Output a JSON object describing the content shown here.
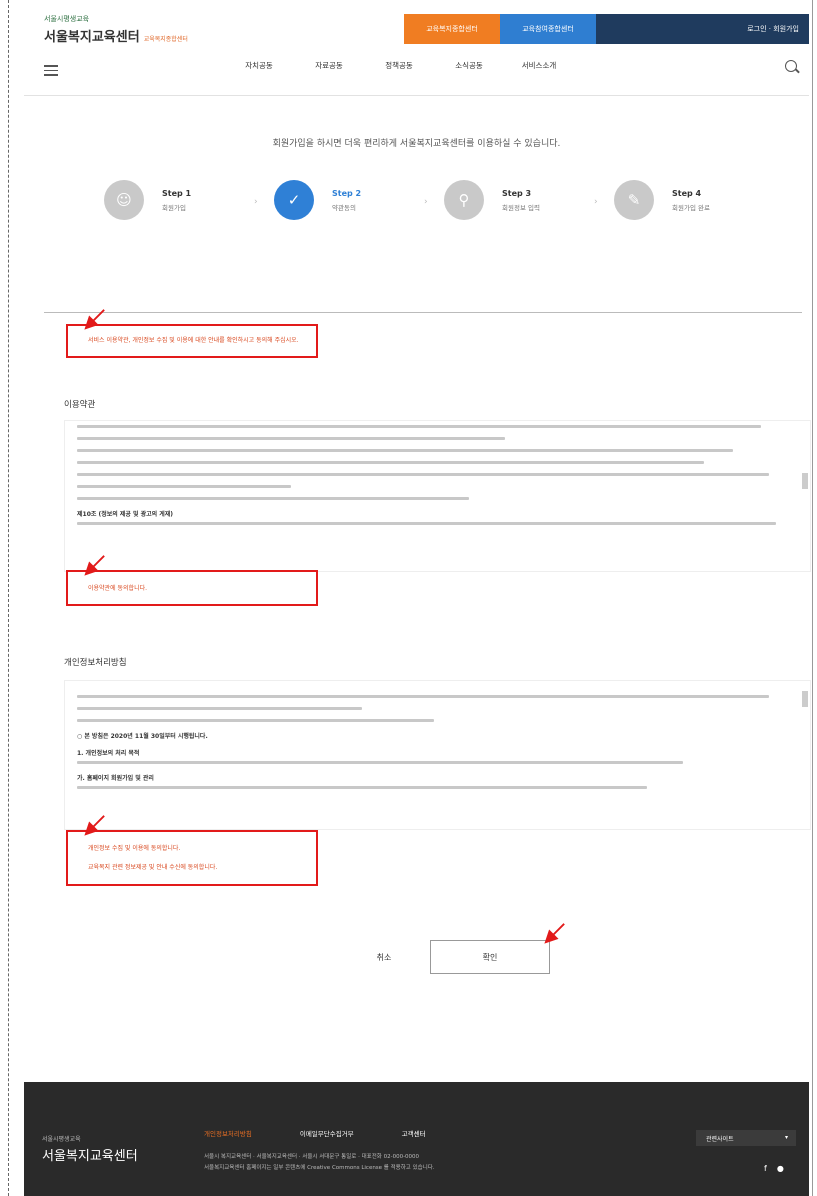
{
  "header": {
    "logo_small": "서울시평생교육",
    "logo_main": "서울복지교육센터",
    "logo_tag": "교육복지종합센터",
    "tab_primary": "교육복지종합센터",
    "tab_secondary": "교육참여종합센터",
    "util_links": "로그인 · 회원가입",
    "nav": [
      "자치공동",
      "자료공동",
      "정책공동",
      "소식공동",
      "서비스소개"
    ]
  },
  "intro": "회원가입을 하시면 더욱 편리하게 서울복지교육센터를 이용하실 수 있습니다.",
  "steps": [
    {
      "num": "Step 1",
      "label": "회원가입"
    },
    {
      "num": "Step 2",
      "label": "약관동의"
    },
    {
      "num": "Step 3",
      "label": "회원정보 입력"
    },
    {
      "num": "Step 4",
      "label": "회원가입 완료"
    }
  ],
  "notice": "서비스 이용약관, 개인정보 수집 및 이용에 대한 안내를 확인하시고 동의해 주십시오.",
  "terms": {
    "title": "이용약관",
    "heading": "제10조 (정보의 제공 및 광고의 게재)",
    "agree_label": "이용약관에 동의합니다."
  },
  "privacy": {
    "title": "개인정보처리방침",
    "effective": "○ 본 방침은 2020년 11월 30일부터 시행됩니다.",
    "heading1": "1. 개인정보의 처리 목적",
    "heading2": "가. 홈페이지 회원가입 및 관리",
    "agree_label_1": "개인정보 수집 및 이용에 동의합니다.",
    "agree_label_2": "교육복지 관련 정보제공 및 안내 수신에 동의합니다."
  },
  "buttons": {
    "cancel": "취소",
    "ok": "확인"
  },
  "footer": {
    "logo_small": "서울시평생교육",
    "logo_main": "서울복지교육센터",
    "links": [
      "개인정보처리방침",
      "이메일무단수집거부",
      "고객센터"
    ],
    "address": "서울시 복지교육센터 · 서울복지교육센터 · 서울시 서대문구 통일로 · 대표전화 02-000-0000",
    "copyright": "서울복지교육센터 홈페이지는 일부 콘텐츠에 Creative Commons License 를 적용하고 있습니다.",
    "related_sites": "관련사이트"
  },
  "colors": {
    "accent_orange": "#f07d22",
    "accent_blue": "#2f80d6",
    "navy": "#1f3b5e",
    "highlight_red": "#e21a1a"
  }
}
